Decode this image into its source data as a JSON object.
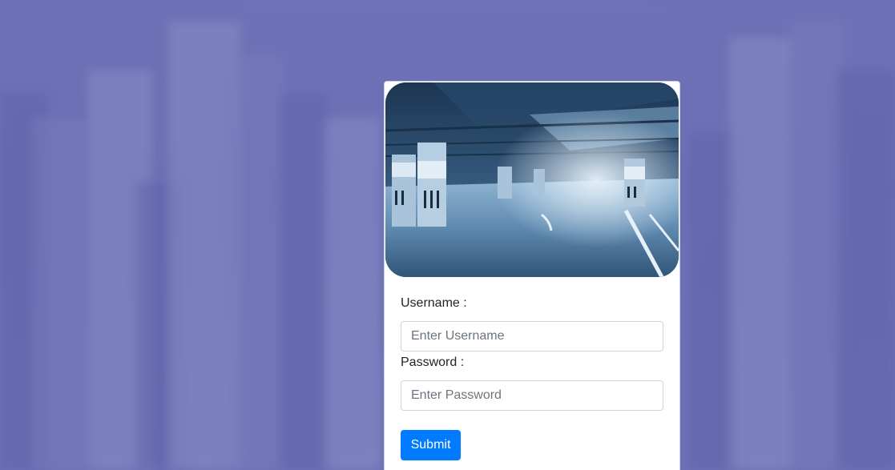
{
  "login_form": {
    "hero_image_alt": "parking garage",
    "username_label": "Username :",
    "username_placeholder": "Enter Username",
    "username_value": "",
    "password_label": "Password :",
    "password_placeholder": "Enter Password",
    "password_value": "",
    "submit_label": "Submit"
  },
  "colors": {
    "background": "#7074b6",
    "accent": "#007bff"
  }
}
